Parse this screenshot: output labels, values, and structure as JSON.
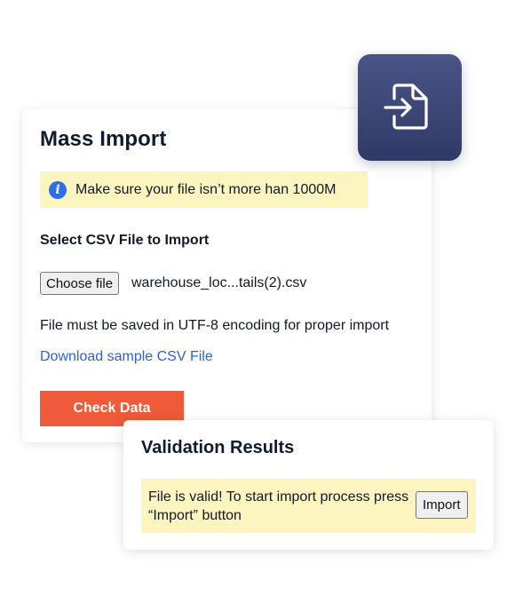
{
  "main_card": {
    "title": "Mass Import",
    "notice": {
      "icon": "info-icon",
      "icon_glyph": "i",
      "text": "Make sure your file isn’t more han 1000M"
    },
    "section_label": "Select CSV File to Import",
    "choose_file_label": "Choose file",
    "file_name": "warehouse_loc...tails(2).csv",
    "encoding_note": "File must be saved in UTF-8 encoding for proper import",
    "download_link": "Download sample CSV File",
    "check_button": "Check Data"
  },
  "import_icon": "file-import-icon",
  "results_card": {
    "title": "Validation Results",
    "message": "File is valid! To start import process press “Import” button",
    "import_button": "Import"
  },
  "colors": {
    "accent_button": "#ee5a3a",
    "notice_bg": "#fdf5c0",
    "link": "#2f5fd7",
    "icon_tile": "#3a4574",
    "info_icon": "#2f6fe8"
  }
}
